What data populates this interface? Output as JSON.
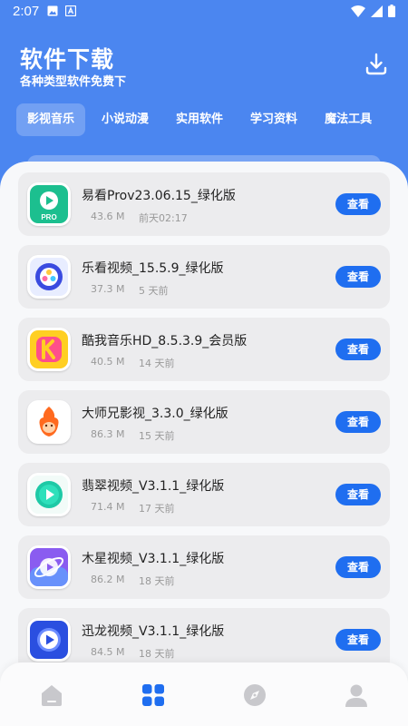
{
  "status_bar": {
    "time": "2:07",
    "icons": [
      "image-icon",
      "a-icon",
      "wifi-icon",
      "signal-icon",
      "battery-icon"
    ]
  },
  "header": {
    "title": "软件下载",
    "subtitle": "各种类型软件免费下",
    "download_icon": "download-icon"
  },
  "tabs": [
    {
      "label": "影视音乐",
      "active": true
    },
    {
      "label": "小说动漫",
      "active": false
    },
    {
      "label": "实用软件",
      "active": false
    },
    {
      "label": "学习资料",
      "active": false
    },
    {
      "label": "魔法工具",
      "active": false
    }
  ],
  "apps": [
    {
      "name": "易看Prov23.06.15_绿化版",
      "size": "43.6 M",
      "time": "前天02:17",
      "button": "查看",
      "icon": "yikan-pro-icon"
    },
    {
      "name": "乐看视频_15.5.9_绿化版",
      "size": "37.3 M",
      "time": "5 天前",
      "button": "查看",
      "icon": "lekan-video-icon"
    },
    {
      "name": "酷我音乐HD_8.5.3.9_会员版",
      "size": "40.5 M",
      "time": "14 天前",
      "button": "查看",
      "icon": "kuwo-music-icon"
    },
    {
      "name": "大师兄影视_3.3.0_绿化版",
      "size": "86.3 M",
      "time": "15 天前",
      "button": "查看",
      "icon": "dashixiong-icon"
    },
    {
      "name": "翡翠视频_V3.1.1_绿化版",
      "size": "71.4 M",
      "time": "17 天前",
      "button": "查看",
      "icon": "feicui-video-icon"
    },
    {
      "name": "木星视频_V3.1.1_绿化版",
      "size": "86.2 M",
      "time": "18 天前",
      "button": "查看",
      "icon": "muxing-video-icon"
    },
    {
      "name": "迅龙视频_V3.1.1_绿化版",
      "size": "84.5 M",
      "time": "18 天前",
      "button": "查看",
      "icon": "xunlong-video-icon"
    }
  ],
  "bottom_nav": [
    {
      "icon": "home-icon",
      "active": false
    },
    {
      "icon": "grid-icon",
      "active": true
    },
    {
      "icon": "compass-icon",
      "active": false
    },
    {
      "icon": "user-icon",
      "active": false
    }
  ],
  "colors": {
    "header_blue": "#4b86f0",
    "button_blue": "#1f6ef0",
    "nav_inactive": "#c8c8cc"
  }
}
